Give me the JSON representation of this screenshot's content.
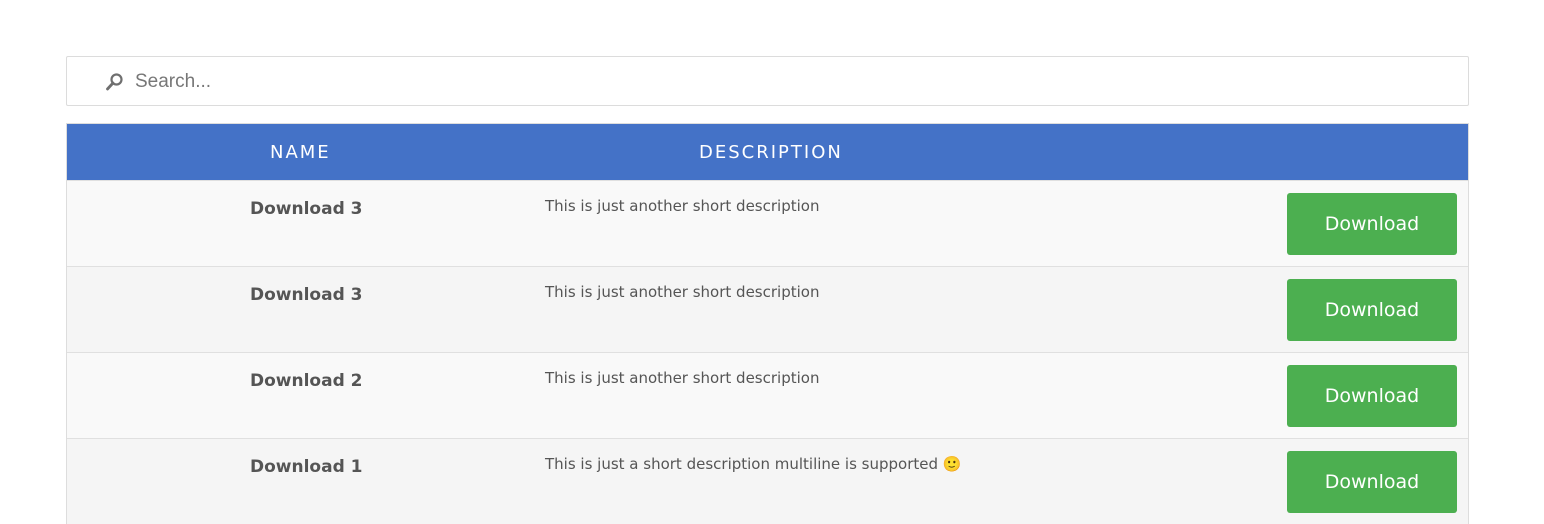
{
  "search": {
    "placeholder": "Search...",
    "value": ""
  },
  "table": {
    "headers": {
      "name": "NAME",
      "description": "DESCRIPTION"
    },
    "rows": [
      {
        "name": "Download 3",
        "description": "This is just another short description",
        "button": "Download"
      },
      {
        "name": "Download 3",
        "description": "This is just another short description",
        "button": "Download"
      },
      {
        "name": "Download 2",
        "description": "This is just another short description",
        "button": "Download"
      },
      {
        "name": "Download 1",
        "description": "This is just a short description multiline is supported 🙂",
        "button": "Download"
      }
    ]
  },
  "colors": {
    "header_bg": "#4472c7",
    "button_bg": "#4caf50",
    "row_odd": "#f9f9f9",
    "row_even": "#f5f5f5"
  },
  "icons": {
    "search": "search-icon"
  }
}
